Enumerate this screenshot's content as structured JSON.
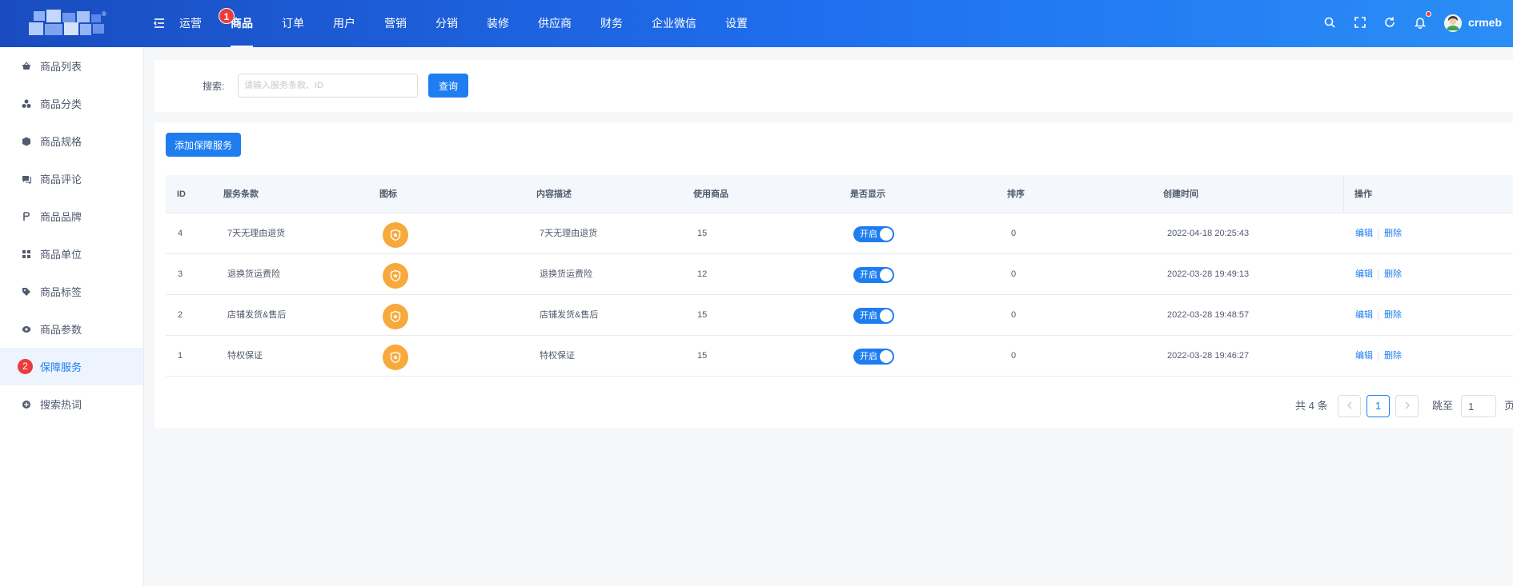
{
  "colors": {
    "primary": "#1e7ef0",
    "header_from": "#1a4cc0",
    "header_to": "#2a8ef6",
    "badge_red": "#ed3b3b",
    "icon_orange": "#f7a93b"
  },
  "header": {
    "nav": [
      {
        "label": "运营",
        "icon": "fold-menu-icon"
      },
      {
        "label": "商品",
        "active": true,
        "step": "1"
      },
      {
        "label": "订单"
      },
      {
        "label": "用户"
      },
      {
        "label": "营销"
      },
      {
        "label": "分销"
      },
      {
        "label": "装修"
      },
      {
        "label": "供应商"
      },
      {
        "label": "财务"
      },
      {
        "label": "企业微信"
      },
      {
        "label": "设置"
      }
    ],
    "tools": [
      "search-icon",
      "fullscreen-icon",
      "refresh-icon",
      "bell-icon"
    ],
    "username": "crmeb"
  },
  "sidebar": {
    "items": [
      {
        "label": "商品列表",
        "icon": "basket-icon"
      },
      {
        "label": "商品分类",
        "icon": "category-icon"
      },
      {
        "label": "商品规格",
        "icon": "cube-icon"
      },
      {
        "label": "商品评论",
        "icon": "comment-icon"
      },
      {
        "label": "商品品牌",
        "icon": "brand-icon"
      },
      {
        "label": "商品单位",
        "icon": "grid-icon"
      },
      {
        "label": "商品标签",
        "icon": "tag-icon"
      },
      {
        "label": "商品参数",
        "icon": "eye-icon"
      },
      {
        "label": "保障服务",
        "icon": "shield-icon",
        "active": true,
        "step": "2"
      },
      {
        "label": "搜索热词",
        "icon": "hot-word-icon"
      }
    ]
  },
  "search": {
    "label": "搜索:",
    "placeholder": "请输入服务条款、ID",
    "value": "",
    "button": "查询"
  },
  "table": {
    "add_button": "添加保障服务",
    "columns": [
      "ID",
      "服务条款",
      "图标",
      "内容描述",
      "使用商品",
      "是否显示",
      "排序",
      "创建时间",
      "操作"
    ],
    "rows": [
      {
        "id": "4",
        "title": "7天无理由退货",
        "icon": "shield-star-icon",
        "desc": "7天无理由退货",
        "count": "15",
        "show": "开启",
        "sort": "0",
        "created": "2022-04-18 20:25:43",
        "edit": "编辑",
        "delete": "删除"
      },
      {
        "id": "3",
        "title": "退换货运费险",
        "icon": "shield-star-icon",
        "desc": "退换货运费险",
        "count": "12",
        "show": "开启",
        "sort": "0",
        "created": "2022-03-28 19:49:13",
        "edit": "编辑",
        "delete": "删除"
      },
      {
        "id": "2",
        "title": "店铺发货&售后",
        "icon": "shield-star-icon",
        "desc": "店铺发货&售后",
        "count": "15",
        "show": "开启",
        "sort": "0",
        "created": "2022-03-28 19:48:57",
        "edit": "编辑",
        "delete": "删除"
      },
      {
        "id": "1",
        "title": "特权保证",
        "icon": "shield-star-icon",
        "desc": "特权保证",
        "count": "15",
        "show": "开启",
        "sort": "0",
        "created": "2022-03-28 19:46:27",
        "edit": "编辑",
        "delete": "删除"
      }
    ]
  },
  "pagination": {
    "total": "共 4 条",
    "current": "1",
    "jump_label": "跳至",
    "jump_value": "1",
    "page_suffix": "页"
  }
}
